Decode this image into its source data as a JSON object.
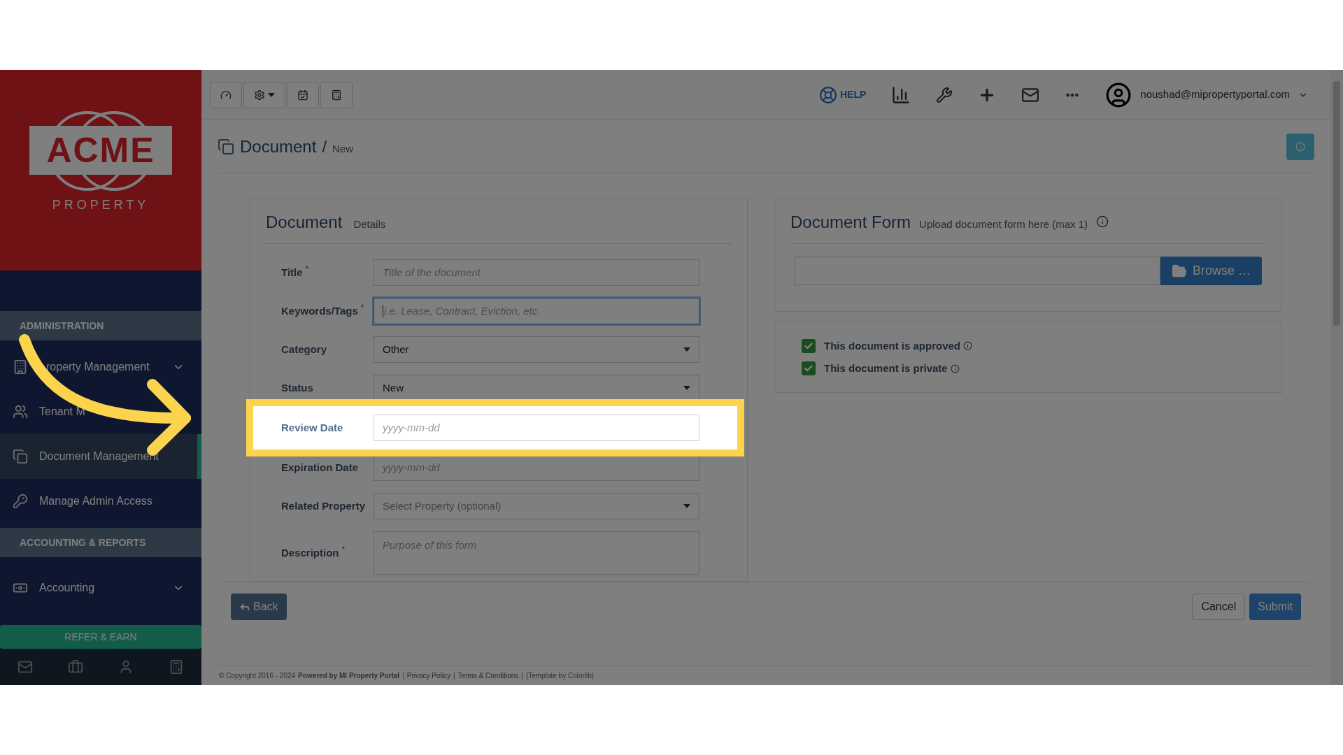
{
  "logo": {
    "name": "ACME",
    "tagline": "PROPERTY"
  },
  "topbar": {
    "help": "HELP",
    "user": "noushad@mipropertyportal.com"
  },
  "sidebar": {
    "sections": [
      {
        "title": "ADMINISTRATION",
        "items": [
          {
            "label": "roperty Management",
            "has_submenu": true,
            "selected": false
          },
          {
            "label": "Tenant M",
            "has_submenu": false,
            "selected": false
          },
          {
            "label": "Document Management",
            "has_submenu": false,
            "selected": true
          },
          {
            "label": "Manage Admin Access",
            "has_submenu": false,
            "selected": false
          }
        ]
      },
      {
        "title": "ACCOUNTING & REPORTS",
        "items": [
          {
            "label": "Accounting",
            "has_submenu": true,
            "selected": false
          }
        ]
      }
    ],
    "refer_button": "REFER & EARN"
  },
  "page": {
    "title": "Document",
    "separator": "/",
    "subtitle": "New"
  },
  "form": {
    "title": "Document",
    "subtitle": "Details",
    "fields": [
      {
        "label": "Title",
        "marker": "*",
        "kind": "text",
        "placeholder": "Title of the document",
        "focused": false,
        "highlighted": false
      },
      {
        "label": "Keywords/Tags",
        "marker": "*",
        "kind": "text",
        "placeholder": "i.e. Lease, Contract, Eviction, etc.",
        "focused": true,
        "highlighted": false
      },
      {
        "label": "Category",
        "kind": "select",
        "value": "Other",
        "focused": false,
        "highlighted": false
      },
      {
        "label": "Status",
        "kind": "select",
        "value": "New",
        "focused": false,
        "highlighted": false
      },
      {
        "label": "Review Date",
        "kind": "text",
        "placeholder": "yyyy-mm-dd",
        "focused": false,
        "highlighted": true
      },
      {
        "label": "Expiration Date",
        "kind": "text",
        "placeholder": "yyyy-mm-dd",
        "focused": false,
        "highlighted": false
      },
      {
        "label": "Related Property",
        "kind": "select",
        "placeholder": "Select Property (optional)",
        "focused": false,
        "highlighted": false
      },
      {
        "label": "Description",
        "marker": "*",
        "kind": "textarea",
        "placeholder": "Purpose of this form",
        "focused": false,
        "highlighted": false
      }
    ]
  },
  "upload": {
    "title": "Document Form",
    "subtitle": "Upload document form here (max 1)",
    "button": "Browse …"
  },
  "options": [
    {
      "label": "This document is approved",
      "checked": true
    },
    {
      "label": "This document is private",
      "checked": true
    }
  ],
  "actions": {
    "back": "Back",
    "cancel": "Cancel",
    "submit": "Submit"
  },
  "footer": [
    {
      "kind": "text",
      "text": "© Copyright 2016 - 2024"
    },
    {
      "kind": "bold",
      "text": "Powered by MI Property Portal"
    },
    {
      "kind": "separator",
      "text": "|"
    },
    {
      "kind": "link",
      "text": "Privacy Policy"
    },
    {
      "kind": "separator",
      "text": "|"
    },
    {
      "kind": "link",
      "text": "Terms & Conditions"
    },
    {
      "kind": "separator",
      "text": "|"
    },
    {
      "kind": "small",
      "text": "(Template by Colorlib)"
    }
  ]
}
